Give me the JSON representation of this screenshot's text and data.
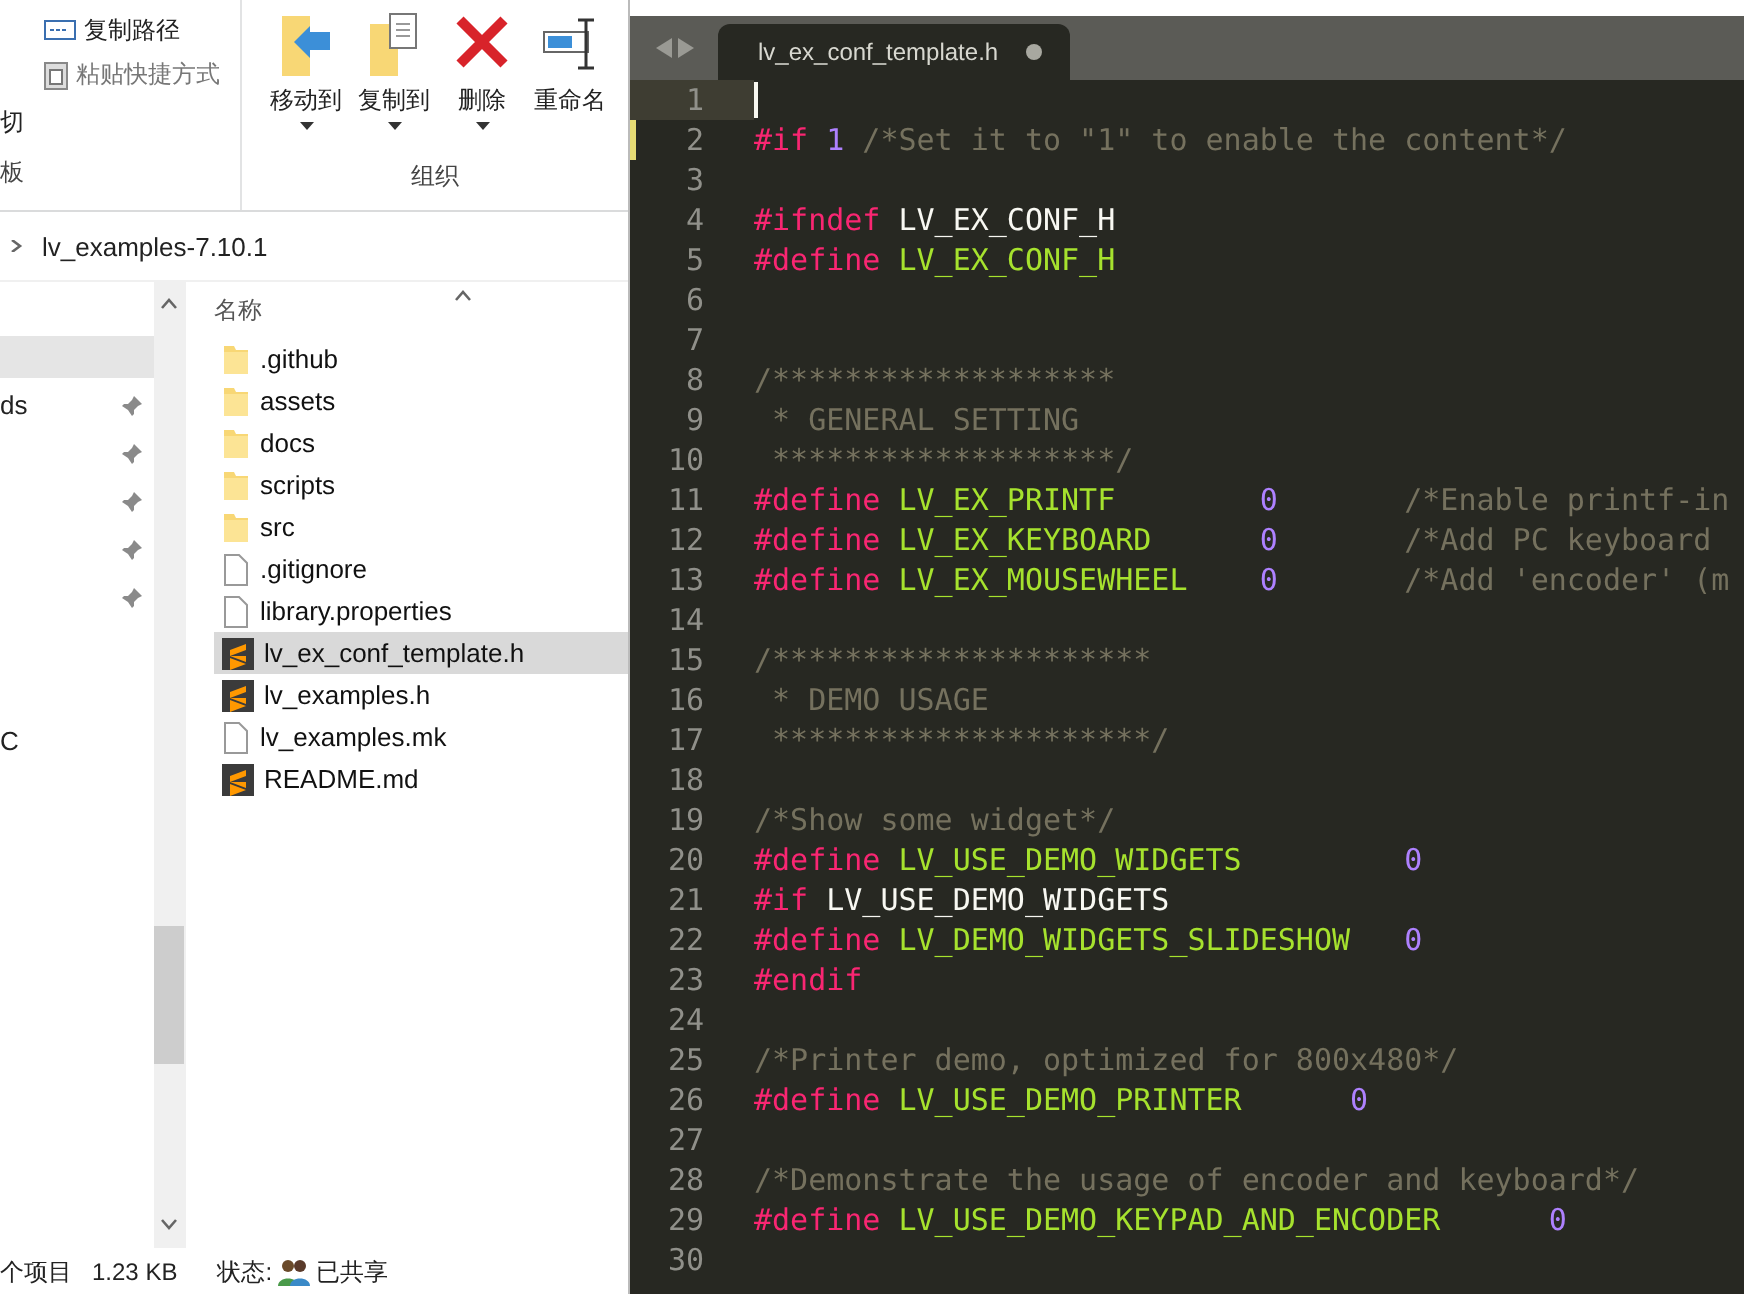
{
  "explorer": {
    "ribbon": {
      "clipboard_items": [
        {
          "label": "复制路径",
          "kind": "path"
        },
        {
          "label": "粘贴快捷方式",
          "kind": "shortcut"
        }
      ],
      "clipboard_cut": "切",
      "clipboard_group": "板",
      "organize_buttons": [
        {
          "label": "移动到",
          "kind": "move",
          "dropdown": true
        },
        {
          "label": "复制到",
          "kind": "copy",
          "dropdown": true
        },
        {
          "label": "删除",
          "kind": "delete",
          "dropdown": true
        },
        {
          "label": "重命名",
          "kind": "rename",
          "dropdown": false
        }
      ],
      "organize_group": "组织"
    },
    "address": {
      "path": "lv_examples-7.10.1"
    },
    "nav_pane": {
      "items": [
        {
          "selected": true,
          "pinned": false
        },
        {
          "label": "ds",
          "selected": false,
          "pinned": true
        },
        {
          "selected": false,
          "pinned": true
        },
        {
          "selected": false,
          "pinned": true
        },
        {
          "selected": false,
          "pinned": true
        },
        {
          "selected": false,
          "pinned": true
        }
      ],
      "lower_item": "C"
    },
    "column_header": "名称",
    "files": [
      {
        "name": ".github",
        "kind": "folder",
        "selected": false
      },
      {
        "name": "assets",
        "kind": "folder",
        "selected": false
      },
      {
        "name": "docs",
        "kind": "folder",
        "selected": false
      },
      {
        "name": "scripts",
        "kind": "folder",
        "selected": false
      },
      {
        "name": "src",
        "kind": "folder",
        "selected": false
      },
      {
        "name": ".gitignore",
        "kind": "file",
        "selected": false
      },
      {
        "name": "library.properties",
        "kind": "file",
        "selected": false
      },
      {
        "name": "lv_ex_conf_template.h",
        "kind": "sublime",
        "selected": true
      },
      {
        "name": "lv_examples.h",
        "kind": "sublime",
        "selected": false
      },
      {
        "name": "lv_examples.mk",
        "kind": "file",
        "selected": false
      },
      {
        "name": "README.md",
        "kind": "sublime",
        "selected": false
      }
    ],
    "status_bar": {
      "count": "个项目",
      "size": "1.23 KB",
      "state_label": "状态:",
      "state": "已共享"
    }
  },
  "editor": {
    "tab": {
      "title": "lv_ex_conf_template.h",
      "modified": true
    },
    "lines": [
      {
        "number": "1",
        "current": true,
        "modified": false
      },
      {
        "number": "2",
        "current": false,
        "modified": true,
        "tokens": [
          {
            "kind": "keyword",
            "text": "#if "
          },
          {
            "kind": "number",
            "text": "1"
          },
          {
            "kind": "comment",
            "text": " /*Set it to \"1\" to enable the content*/"
          }
        ]
      },
      {
        "number": "3",
        "current": false,
        "modified": false
      },
      {
        "number": "4",
        "current": false,
        "modified": false,
        "tokens": [
          {
            "kind": "keyword",
            "text": "#ifndef"
          },
          {
            "kind": "plain",
            "text": " LV_EX_CONF_H"
          }
        ]
      },
      {
        "number": "5",
        "current": false,
        "modified": false,
        "tokens": [
          {
            "kind": "keyword",
            "text": "#define"
          },
          {
            "kind": "macro",
            "text": " LV_EX_CONF_H"
          }
        ]
      },
      {
        "number": "6",
        "current": false,
        "modified": false
      },
      {
        "number": "7",
        "current": false,
        "modified": false
      },
      {
        "number": "8",
        "current": false,
        "modified": false,
        "tokens": [
          {
            "kind": "comment",
            "text": "/*******************"
          }
        ]
      },
      {
        "number": "9",
        "current": false,
        "modified": false,
        "tokens": [
          {
            "kind": "comment",
            "text": " * GENERAL SETTING"
          }
        ]
      },
      {
        "number": "10",
        "current": false,
        "modified": false,
        "tokens": [
          {
            "kind": "comment",
            "text": " *******************/"
          }
        ]
      },
      {
        "number": "11",
        "current": false,
        "modified": false,
        "tokens": [
          {
            "kind": "keyword",
            "text": "#define"
          },
          {
            "kind": "macro",
            "text": " LV_EX_PRINTF        "
          },
          {
            "kind": "number",
            "text": "0"
          },
          {
            "kind": "comment",
            "text": "       /*Enable printf-in"
          }
        ]
      },
      {
        "number": "12",
        "current": false,
        "modified": false,
        "tokens": [
          {
            "kind": "keyword",
            "text": "#define"
          },
          {
            "kind": "macro",
            "text": " LV_EX_KEYBOARD      "
          },
          {
            "kind": "number",
            "text": "0"
          },
          {
            "kind": "comment",
            "text": "       /*Add PC keyboard"
          }
        ]
      },
      {
        "number": "13",
        "current": false,
        "modified": false,
        "tokens": [
          {
            "kind": "keyword",
            "text": "#define"
          },
          {
            "kind": "macro",
            "text": " LV_EX_MOUSEWHEEL    "
          },
          {
            "kind": "number",
            "text": "0"
          },
          {
            "kind": "comment",
            "text": "       /*Add 'encoder' (m"
          }
        ]
      },
      {
        "number": "14",
        "current": false,
        "modified": false
      },
      {
        "number": "15",
        "current": false,
        "modified": false,
        "tokens": [
          {
            "kind": "comment",
            "text": "/*********************"
          }
        ]
      },
      {
        "number": "16",
        "current": false,
        "modified": false,
        "tokens": [
          {
            "kind": "comment",
            "text": " * DEMO USAGE"
          }
        ]
      },
      {
        "number": "17",
        "current": false,
        "modified": false,
        "tokens": [
          {
            "kind": "comment",
            "text": " *********************/"
          }
        ]
      },
      {
        "number": "18",
        "current": false,
        "modified": false
      },
      {
        "number": "19",
        "current": false,
        "modified": false,
        "tokens": [
          {
            "kind": "comment",
            "text": "/*Show some widget*/"
          }
        ]
      },
      {
        "number": "20",
        "current": false,
        "modified": false,
        "tokens": [
          {
            "kind": "keyword",
            "text": "#define"
          },
          {
            "kind": "macro",
            "text": " LV_USE_DEMO_WIDGETS         "
          },
          {
            "kind": "number",
            "text": "0"
          }
        ]
      },
      {
        "number": "21",
        "current": false,
        "modified": false,
        "tokens": [
          {
            "kind": "keyword",
            "text": "#if"
          },
          {
            "kind": "plain",
            "text": " LV_USE_DEMO_WIDGETS"
          }
        ]
      },
      {
        "number": "22",
        "current": false,
        "modified": false,
        "tokens": [
          {
            "kind": "keyword",
            "text": "#define"
          },
          {
            "kind": "macro",
            "text": " LV_DEMO_WIDGETS_SLIDESHOW   "
          },
          {
            "kind": "number",
            "text": "0"
          }
        ]
      },
      {
        "number": "23",
        "current": false,
        "modified": false,
        "tokens": [
          {
            "kind": "keyword",
            "text": "#endif"
          }
        ]
      },
      {
        "number": "24",
        "current": false,
        "modified": false
      },
      {
        "number": "25",
        "current": false,
        "modified": false,
        "tokens": [
          {
            "kind": "comment",
            "text": "/*Printer demo, optimized for 800x480*/"
          }
        ]
      },
      {
        "number": "26",
        "current": false,
        "modified": false,
        "tokens": [
          {
            "kind": "keyword",
            "text": "#define"
          },
          {
            "kind": "macro",
            "text": " LV_USE_DEMO_PRINTER      "
          },
          {
            "kind": "number",
            "text": "0"
          }
        ]
      },
      {
        "number": "27",
        "current": false,
        "modified": false
      },
      {
        "number": "28",
        "current": false,
        "modified": false,
        "tokens": [
          {
            "kind": "comment",
            "text": "/*Demonstrate the usage of encoder and keyboard*/"
          }
        ]
      },
      {
        "number": "29",
        "current": false,
        "modified": false,
        "tokens": [
          {
            "kind": "keyword",
            "text": "#define"
          },
          {
            "kind": "macro",
            "text": " LV_USE_DEMO_KEYPAD_AND_ENCODER      "
          },
          {
            "kind": "number",
            "text": "0"
          }
        ]
      },
      {
        "number": "30",
        "current": false,
        "modified": false
      }
    ]
  }
}
